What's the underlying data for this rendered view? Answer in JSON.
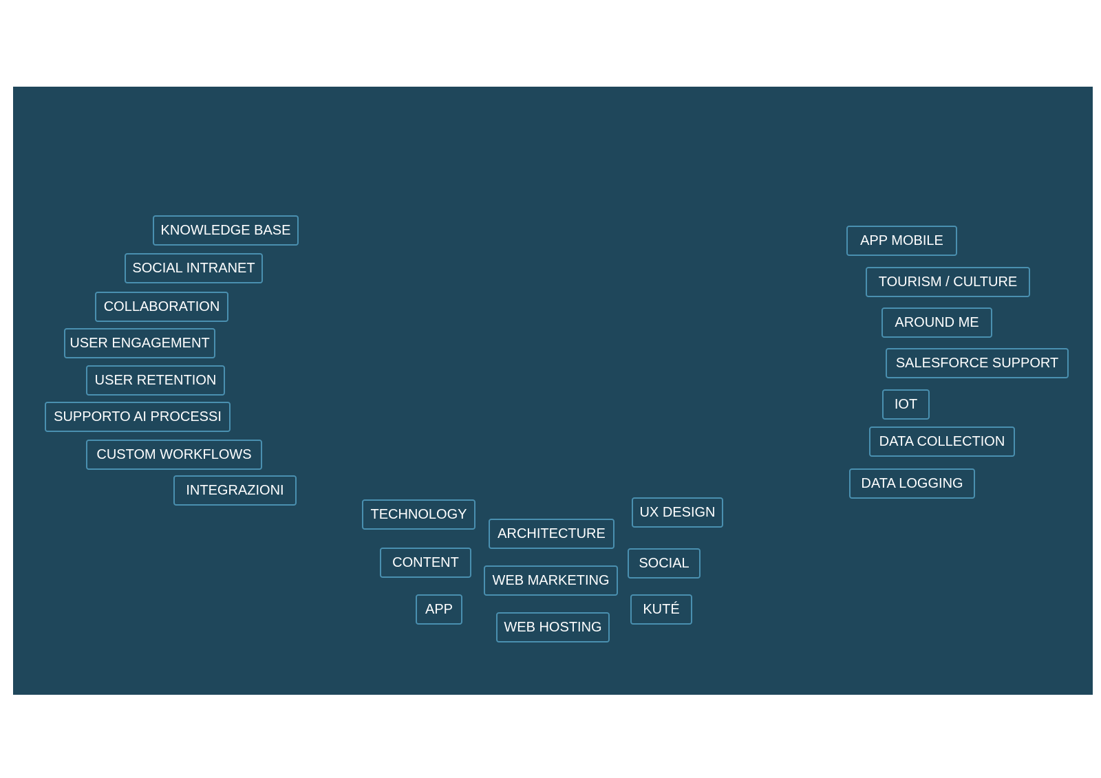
{
  "colors": {
    "background": "#1f475b",
    "tag_border": "#4a90b0",
    "tag_text": "#ffffff",
    "page": "#ffffff"
  },
  "left_group": [
    "KNOWLEDGE BASE",
    "SOCIAL INTRANET",
    "COLLABORATION",
    "USER ENGAGEMENT",
    "USER RETENTION",
    "SUPPORTO AI PROCESSI",
    "CUSTOM WORKFLOWS",
    "INTEGRAZIONI"
  ],
  "center_group": [
    "TECHNOLOGY",
    "ARCHITECTURE",
    "UX DESIGN",
    "CONTENT",
    "WEB MARKETING",
    "SOCIAL",
    "APP",
    "WEB HOSTING",
    "KUTÉ"
  ],
  "right_group": [
    "APP MOBILE",
    "TOURISM / CULTURE",
    "AROUND ME",
    "SALESFORCE SUPPORT",
    "IOT",
    "DATA COLLECTION",
    "DATA LOGGING"
  ]
}
